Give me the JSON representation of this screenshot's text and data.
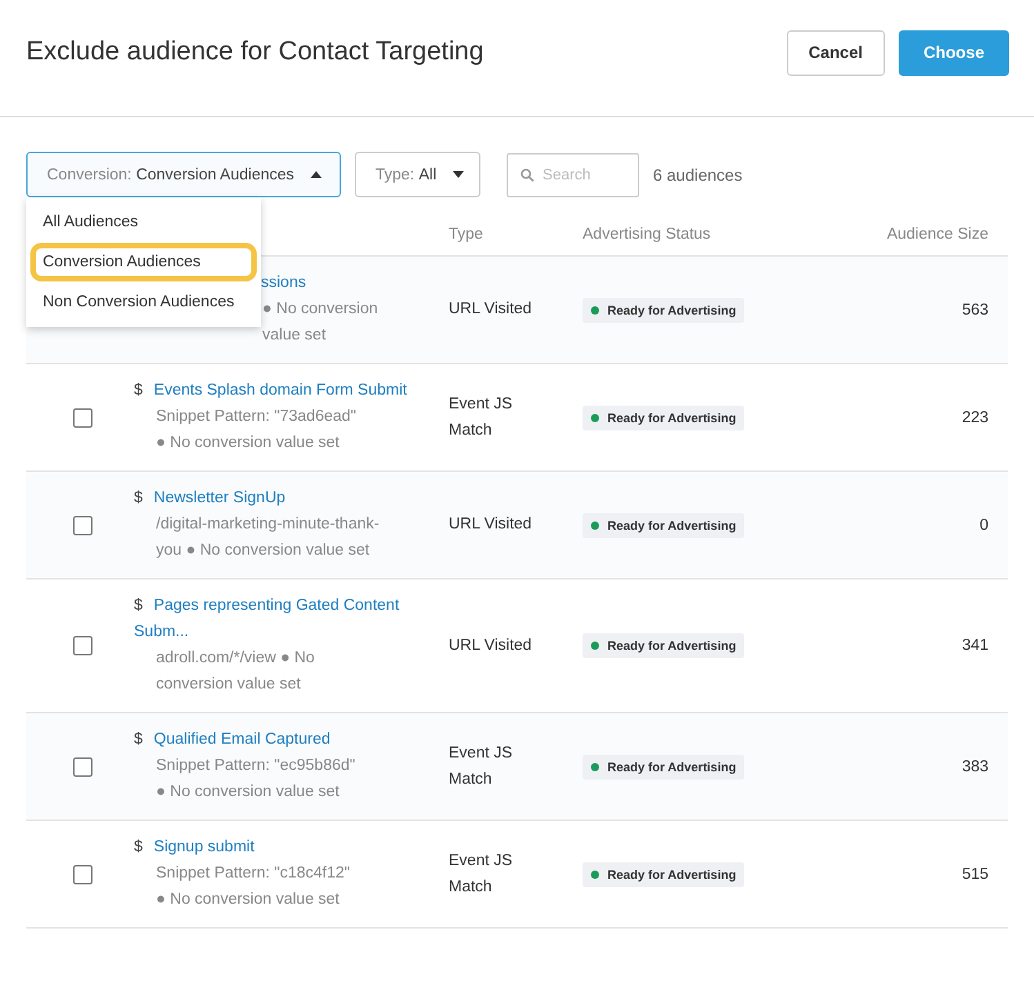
{
  "dialog": {
    "title": "Exclude audience for Contact Targeting",
    "buttons": [
      {
        "label": "Cancel",
        "kind": "secondary"
      },
      {
        "label": "Choose",
        "kind": "primary"
      }
    ]
  },
  "filters": {
    "conversion": {
      "label": "Conversion:",
      "value": "Conversion Audiences",
      "expanded": true,
      "options": [
        {
          "label": "All Audiences",
          "selected": false
        },
        {
          "label": "Conversion Audiences",
          "selected": true
        },
        {
          "label": "Non Conversion Audiences",
          "selected": false
        }
      ]
    },
    "type": {
      "label": "Type:",
      "value": "All"
    },
    "search": {
      "placeholder": "Search"
    },
    "count": "6 audiences"
  },
  "table": {
    "columns": [
      "Type",
      "Advertising Status",
      "Audience Size"
    ],
    "rows": [
      {
        "covered": true,
        "name": "ssions",
        "detail": "● No conversion value set",
        "type": "URL Visited",
        "status": "Ready for Advertising",
        "size": "563"
      },
      {
        "covered": false,
        "checked": false,
        "currency": "$",
        "name": "Events Splash domain Form Submit",
        "detail": "Snippet Pattern: \"73ad6ead\" ● No conversion value set",
        "type": "Event JS Match",
        "status": "Ready for Advertising",
        "size": "223"
      },
      {
        "covered": false,
        "checked": false,
        "currency": "$",
        "name": "Newsletter SignUp",
        "detail": "/digital-marketing-minute-thank-you ● No conversion value set",
        "type": "URL Visited",
        "status": "Ready for Advertising",
        "size": "0"
      },
      {
        "covered": false,
        "checked": false,
        "currency": "$",
        "name": "Pages representing Gated Content Subm...",
        "detail": "adroll.com/*/view ● No conversion value set",
        "type": "URL Visited",
        "status": "Ready for Advertising",
        "size": "341"
      },
      {
        "covered": false,
        "checked": false,
        "currency": "$",
        "name": "Qualified Email Captured",
        "detail": "Snippet Pattern: \"ec95b86d\" ● No conversion value set",
        "type": "Event JS Match",
        "status": "Ready for Advertising",
        "size": "383"
      },
      {
        "covered": false,
        "checked": false,
        "currency": "$",
        "name": "Signup submit",
        "detail": "Snippet Pattern: \"c18c4f12\" ● No conversion value set",
        "type": "Event JS Match",
        "status": "Ready for Advertising",
        "size": "515"
      }
    ]
  }
}
